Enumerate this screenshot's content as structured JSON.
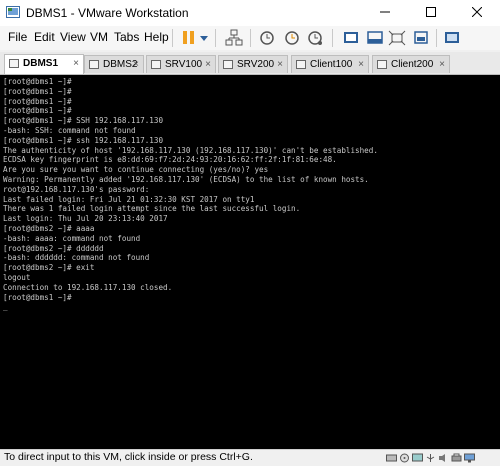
{
  "window": {
    "title": "DBMS1 - VMware Workstation"
  },
  "menu": [
    {
      "label": "File"
    },
    {
      "label": "Edit"
    },
    {
      "label": "View"
    },
    {
      "label": "VM"
    },
    {
      "label": "Tabs"
    },
    {
      "label": "Help"
    }
  ],
  "toolbar_icons": [
    "pause-icon",
    "dropdown-icon",
    "network-icon",
    "snapshot-icon",
    "revert-snapshot-icon",
    "snapshot-manager-icon",
    "fullscreen-icon",
    "unity-icon",
    "fit-guest-icon",
    "thumbnail-icon",
    "console-view-icon"
  ],
  "tabs": [
    {
      "label": "DBMS1",
      "active": true
    },
    {
      "label": "DBMS2",
      "active": false
    },
    {
      "label": "SRV100",
      "active": false
    },
    {
      "label": "SRV200",
      "active": false
    },
    {
      "label": "Client100",
      "active": false
    },
    {
      "label": "Client200",
      "active": false
    }
  ],
  "console": {
    "lines": [
      "[root@dbms1 ~]#",
      "[root@dbms1 ~]#",
      "[root@dbms1 ~]#",
      "[root@dbms1 ~]#",
      "[root@dbms1 ~]# SSH 192.168.117.130",
      "-bash: SSH: command not found",
      "[root@dbms1 ~]# ssh 192.168.117.130",
      "The authenticity of host '192.168.117.130 (192.168.117.130)' can't be established.",
      "ECDSA key fingerprint is e8:dd:69:f7:2d:24:93:20:16:62:ff:2f:1f:81:6e:48.",
      "Are you sure you want to continue connecting (yes/no)? yes",
      "Warning: Permanently added '192.168.117.130' (ECDSA) to the list of known hosts.",
      "root@192.168.117.130's password:",
      "Last failed login: Fri Jul 21 01:32:30 KST 2017 on tty1",
      "There was 1 failed login attempt since the last successful login.",
      "Last login: Thu Jul 20 23:13:40 2017",
      "[root@dbms2 ~]# aaaa",
      "-bash: aaaa: command not found",
      "[root@dbms2 ~]# dddddd",
      "-bash: dddddd: command not found",
      "[root@dbms2 ~]# exit",
      "logout",
      "Connection to 192.168.117.130 closed.",
      "[root@dbms1 ~]#"
    ]
  },
  "status": {
    "text": "To direct input to this VM, click inside or press Ctrl+G."
  },
  "status_icons": [
    "hard-disk-icon",
    "cd-icon",
    "network-adapter-icon",
    "usb-icon",
    "sound-icon",
    "printer-icon",
    "display-icon"
  ]
}
